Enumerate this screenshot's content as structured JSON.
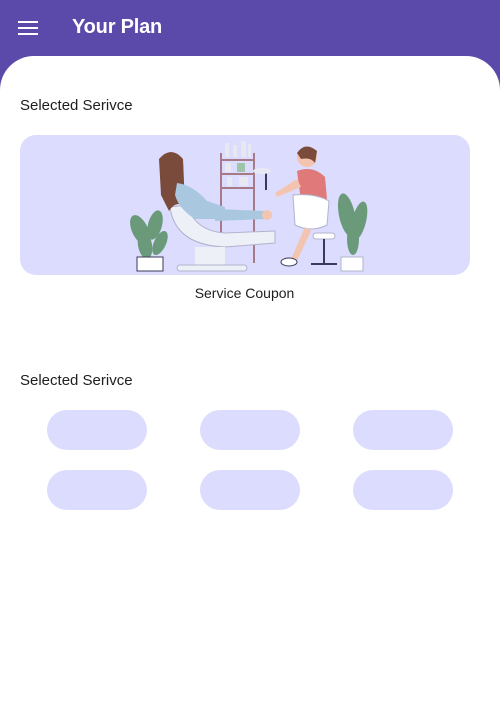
{
  "appbar": {
    "title": "Your Plan",
    "menu_icon": "hamburger-menu-icon",
    "background": "#5b4aa9"
  },
  "sections": [
    {
      "title": "Selected Serivce",
      "card": {
        "label": "Service Coupon",
        "illustration": "pedicure-salon-illustration",
        "background": "#dcdcff"
      }
    },
    {
      "title": "Selected Serivce",
      "options": [
        "",
        "",
        "",
        "",
        "",
        ""
      ]
    }
  ]
}
